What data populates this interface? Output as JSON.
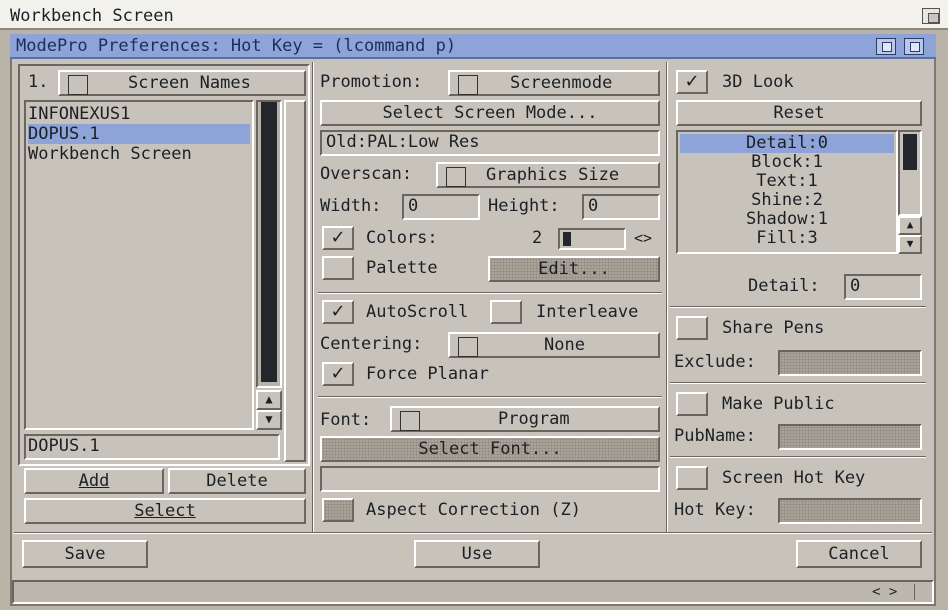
{
  "screen": {
    "title": "Workbench Screen"
  },
  "window": {
    "title": "ModePro Preferences: Hot Key = (lcommand p)"
  },
  "left": {
    "number": "1.",
    "cycle_label": "Screen Names",
    "list": [
      "INFONEXUS1",
      "DOPUS.1",
      "Workbench Screen"
    ],
    "selected_index": 1,
    "name_value": "DOPUS.1",
    "add": "Add",
    "delete": "Delete",
    "select": "Select"
  },
  "middle": {
    "promotion_label": "Promotion:",
    "promotion_value": "Screenmode",
    "select_mode": "Select Screen Mode...",
    "mode_text": "Old:PAL:Low Res",
    "overscan_label": "Overscan:",
    "overscan_value": "Graphics Size",
    "width_label": "Width:",
    "width_value": "0",
    "height_label": "Height:",
    "height_value": "0",
    "colors_label": "Colors:",
    "colors_value": "2",
    "colors_arrows": "<>",
    "palette_label": "Palette",
    "edit": "Edit...",
    "autoscroll": "AutoScroll",
    "interleave": "Interleave",
    "centering_label": "Centering:",
    "centering_value": "None",
    "force_planar": "Force Planar",
    "font_label": "Font:",
    "font_value": "Program",
    "select_font": "Select Font...",
    "aspect": "Aspect Correction (Z)"
  },
  "right": {
    "look3d": "3D Look",
    "reset": "Reset",
    "pens": [
      "Detail:0",
      "Block:1",
      "Text:1",
      "Shine:2",
      "Shadow:1",
      "Fill:3"
    ],
    "detail_label": "Detail:",
    "detail_value": "0",
    "share_pens": "Share Pens",
    "exclude_label": "Exclude:",
    "make_public": "Make Public",
    "pubname_label": "PubName:",
    "screen_hotkey": "Screen Hot Key",
    "hotkey_label": "Hot Key:"
  },
  "bottom": {
    "save": "Save",
    "use": "Use",
    "cancel": "Cancel"
  },
  "status": {
    "scroll_arrows": "< >"
  }
}
